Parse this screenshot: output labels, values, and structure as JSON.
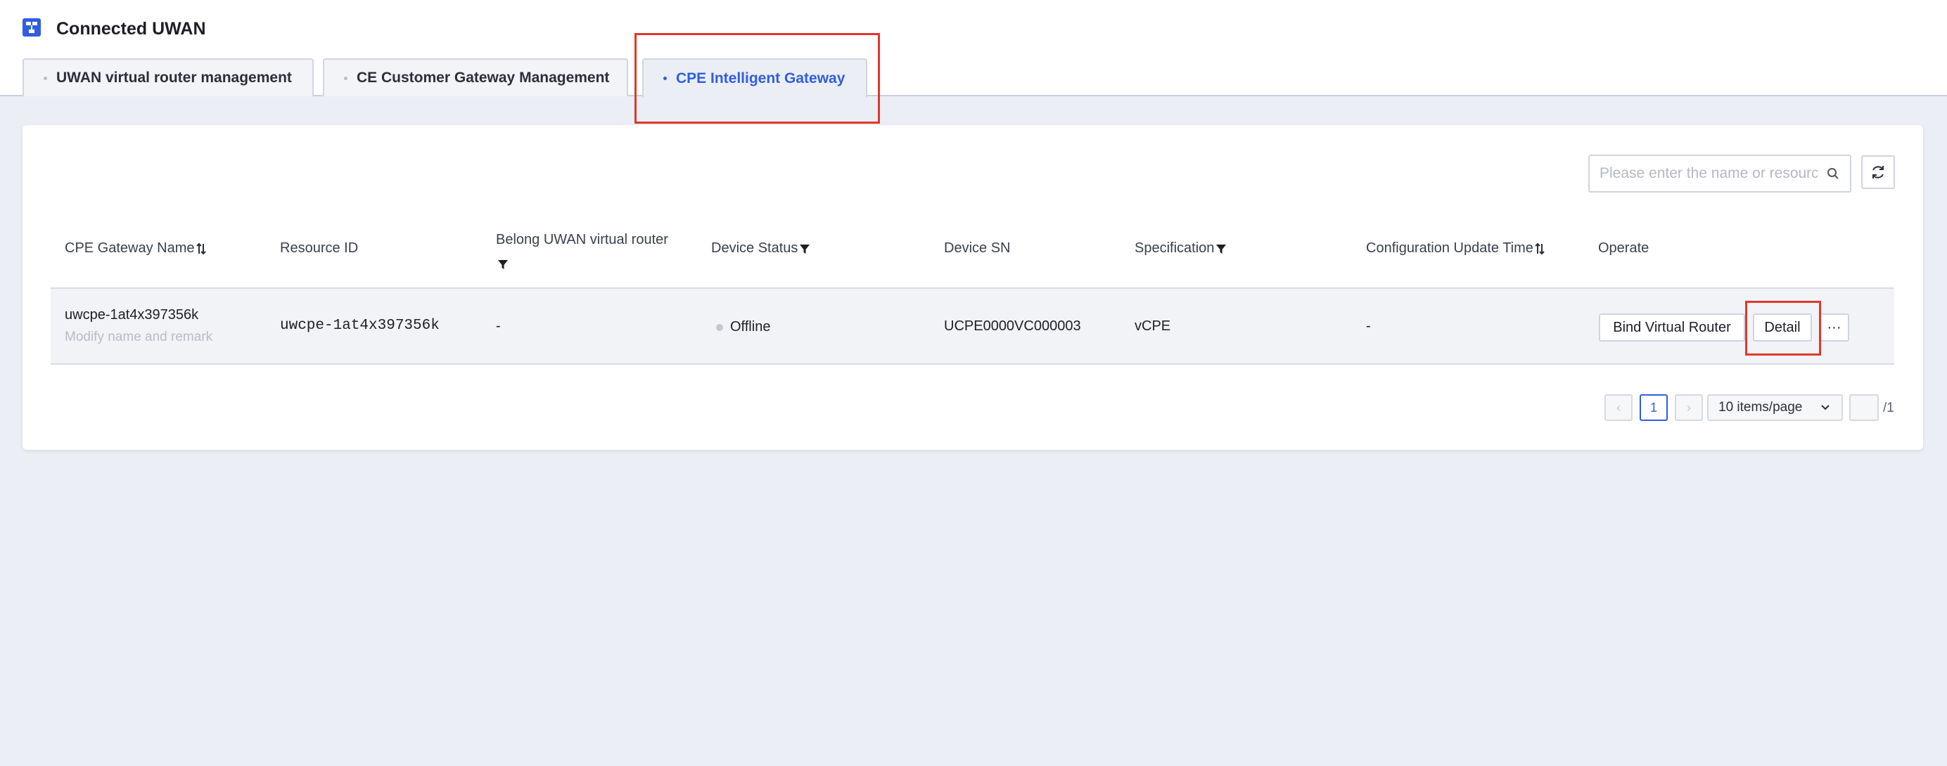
{
  "header": {
    "title": "Connected UWAN",
    "icon": "network-topology-icon"
  },
  "tabs": [
    {
      "label": "UWAN virtual router management",
      "active": false
    },
    {
      "label": "CE Customer Gateway Management",
      "active": false
    },
    {
      "label": "CPE Intelligent Gateway",
      "active": true
    }
  ],
  "toolbar": {
    "search_placeholder": "Please enter the name or resource ID",
    "search_value": "",
    "refresh_icon": "refresh-icon"
  },
  "table": {
    "columns": [
      "CPE Gateway Name",
      "Resource ID",
      "Belong UWAN virtual router",
      "Device Status",
      "Device SN",
      "Specification",
      "Configuration Update Time",
      "Operate"
    ],
    "rows": [
      {
        "name": "uwcpe-1at4x397356k",
        "remark": "Modify name and remark",
        "resource_id": "uwcpe-1at4x397356k",
        "router": "-",
        "status": "Offline",
        "sn": "UCPE0000VC000003",
        "spec": "vCPE",
        "update_time": "-",
        "actions": {
          "bind": "Bind Virtual Router",
          "detail": "Detail",
          "more": "···"
        }
      }
    ]
  },
  "pagination": {
    "prev": "‹",
    "current_page": "1",
    "next": "›",
    "page_size": "10 items/page",
    "page_input": "",
    "total_pages": "/1"
  },
  "colors": {
    "accent": "#2f5ee0",
    "highlight": "#e0382b",
    "status_offline": "#c4c7cf"
  }
}
